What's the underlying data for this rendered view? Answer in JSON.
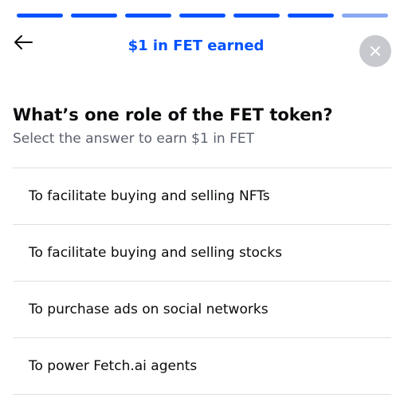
{
  "progress": {
    "total_steps": 7,
    "completed_steps": 6,
    "active_color": "#0052ff",
    "pending_color": "#8aa8f5"
  },
  "header": {
    "back_icon": "arrow-left-icon",
    "title": "$1 in FET earned",
    "title_color": "#0052ff",
    "close_icon": "close-icon"
  },
  "quiz": {
    "question": "What’s one role of the FET token?",
    "subtitle": "Select the answer to earn $1 in FET",
    "answers": [
      {
        "label": "To facilitate buying and selling NFTs"
      },
      {
        "label": "To facilitate buying and selling stocks"
      },
      {
        "label": "To purchase ads on social networks"
      },
      {
        "label": "To power Fetch.ai agents"
      }
    ]
  }
}
